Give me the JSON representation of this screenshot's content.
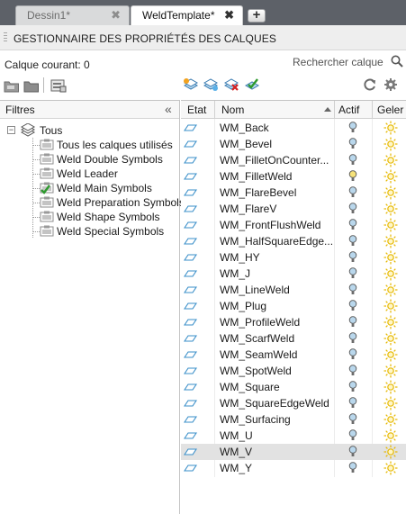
{
  "tabs": [
    {
      "label": "Dessin1*",
      "close": "✖",
      "active": false
    },
    {
      "label": "WeldTemplate*",
      "close": "✖",
      "active": true
    }
  ],
  "new_tab_label": "+",
  "palette": {
    "title": "GESTIONNAIRE DES PROPRIÉTÉS DES CALQUES",
    "current_layer": "Calque courant: 0",
    "search_placeholder": "Rechercher calque"
  },
  "filters": {
    "title": "Filtres",
    "collapse": "«",
    "root": "Tous",
    "items": [
      {
        "label": "Tous les calques utilisés",
        "checked": false
      },
      {
        "label": "Weld Double Symbols",
        "checked": false
      },
      {
        "label": "Weld Leader",
        "checked": false
      },
      {
        "label": "Weld Main Symbols",
        "checked": true
      },
      {
        "label": "Weld Preparation Symbols",
        "checked": false
      },
      {
        "label": "Weld Shape Symbols",
        "checked": false
      },
      {
        "label": "Weld Special Symbols",
        "checked": false
      }
    ]
  },
  "grid": {
    "columns": {
      "etat": "Etat",
      "nom": "Nom",
      "actif": "Actif",
      "geler": "Geler"
    },
    "rows": [
      {
        "name": "WM_Back",
        "selected": false,
        "active_bulb": false
      },
      {
        "name": "WM_Bevel",
        "selected": false,
        "active_bulb": false
      },
      {
        "name": "WM_FilletOnCounter...",
        "selected": false,
        "active_bulb": false
      },
      {
        "name": "WM_FilletWeld",
        "selected": false,
        "active_bulb": true
      },
      {
        "name": "WM_FlareBevel",
        "selected": false,
        "active_bulb": false
      },
      {
        "name": "WM_FlareV",
        "selected": false,
        "active_bulb": false
      },
      {
        "name": "WM_FrontFlushWeld",
        "selected": false,
        "active_bulb": false
      },
      {
        "name": "WM_HalfSquareEdge...",
        "selected": false,
        "active_bulb": false
      },
      {
        "name": "WM_HY",
        "selected": false,
        "active_bulb": false
      },
      {
        "name": "WM_J",
        "selected": false,
        "active_bulb": false
      },
      {
        "name": "WM_LineWeld",
        "selected": false,
        "active_bulb": false
      },
      {
        "name": "WM_Plug",
        "selected": false,
        "active_bulb": false
      },
      {
        "name": "WM_ProfileWeld",
        "selected": false,
        "active_bulb": false
      },
      {
        "name": "WM_ScarfWeld",
        "selected": false,
        "active_bulb": false
      },
      {
        "name": "WM_SeamWeld",
        "selected": false,
        "active_bulb": false
      },
      {
        "name": "WM_SpotWeld",
        "selected": false,
        "active_bulb": false
      },
      {
        "name": "WM_Square",
        "selected": false,
        "active_bulb": false
      },
      {
        "name": "WM_SquareEdgeWeld",
        "selected": false,
        "active_bulb": false
      },
      {
        "name": "WM_Surfacing",
        "selected": false,
        "active_bulb": false
      },
      {
        "name": "WM_U",
        "selected": false,
        "active_bulb": false
      },
      {
        "name": "WM_V",
        "selected": true,
        "active_bulb": false
      },
      {
        "name": "WM_Y",
        "selected": false,
        "active_bulb": false
      }
    ]
  },
  "icons": {
    "toolbar_left": [
      "new-property-filter-icon",
      "new-group-filter-icon",
      "layer-states-manager-icon"
    ],
    "toolbar_right": [
      "new-layer-icon",
      "new-layer-vp-frozen-icon",
      "delete-layer-icon",
      "set-current-icon",
      "refresh-icon",
      "settings-icon"
    ],
    "search": "magnifier-icon"
  },
  "colors": {
    "tabbar_bg": "#5d6168",
    "status_icon": "#3a8fc9",
    "bulb_on": "#f6e27a",
    "bulb_off": "#b9d7ec",
    "sun": "#e6b800",
    "check": "#2e9a2e",
    "selected_row": "#e2e2e2"
  }
}
